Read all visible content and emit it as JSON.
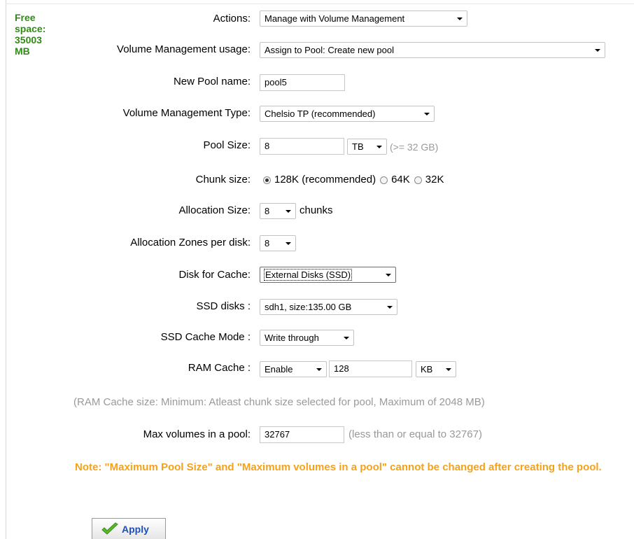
{
  "free_space": [
    "Free",
    "space:",
    "35003",
    "MB"
  ],
  "actions": {
    "label": "Actions:",
    "value": "Manage with Volume Management"
  },
  "vm_usage": {
    "label": "Volume Management usage:",
    "value": "Assign to Pool: Create new pool"
  },
  "pool_name": {
    "label": "New Pool name:",
    "value": "pool5"
  },
  "vm_type": {
    "label": "Volume Management Type:",
    "value": "Chelsio TP (recommended)"
  },
  "pool_size": {
    "label": "Pool Size:",
    "value": "8",
    "unit": "TB",
    "hint": "(>= 32 GB)"
  },
  "chunk_size": {
    "label": "Chunk size:",
    "options": [
      {
        "label": "128K (recommended)",
        "selected": true
      },
      {
        "label": "64K",
        "selected": false
      },
      {
        "label": "32K",
        "selected": false
      }
    ]
  },
  "allocation_size": {
    "label": "Allocation Size:",
    "value": "8",
    "unit": "chunks"
  },
  "allocation_zones": {
    "label": "Allocation Zones per disk:",
    "value": "8"
  },
  "disk_cache": {
    "label": "Disk for Cache:",
    "value": "External Disks (SSD)"
  },
  "ssd_disks": {
    "label": "SSD disks :",
    "value": "sdh1, size:135.00 GB"
  },
  "ssd_cache_mode": {
    "label": "SSD Cache Mode :",
    "value": "Write through"
  },
  "ram_cache": {
    "label": "RAM Cache :",
    "mode": "Enable",
    "size": "128",
    "unit": "KB"
  },
  "ram_cache_note": "(RAM Cache size: Minimum: Atleast chunk size selected for pool, Maximum of 2048 MB)",
  "max_volumes": {
    "label": "Max volumes in a pool:",
    "value": "32767",
    "hint": "(less than or equal to 32767)"
  },
  "note": "Note: \"Maximum Pool Size\" and \"Maximum volumes in a pool\" cannot be changed after creating the pool.",
  "apply_label": "Apply",
  "colors": {
    "free_space": "#2e8b14",
    "note": "#f5a21a",
    "hint": "#999999",
    "apply_text": "#1f4fb5"
  }
}
